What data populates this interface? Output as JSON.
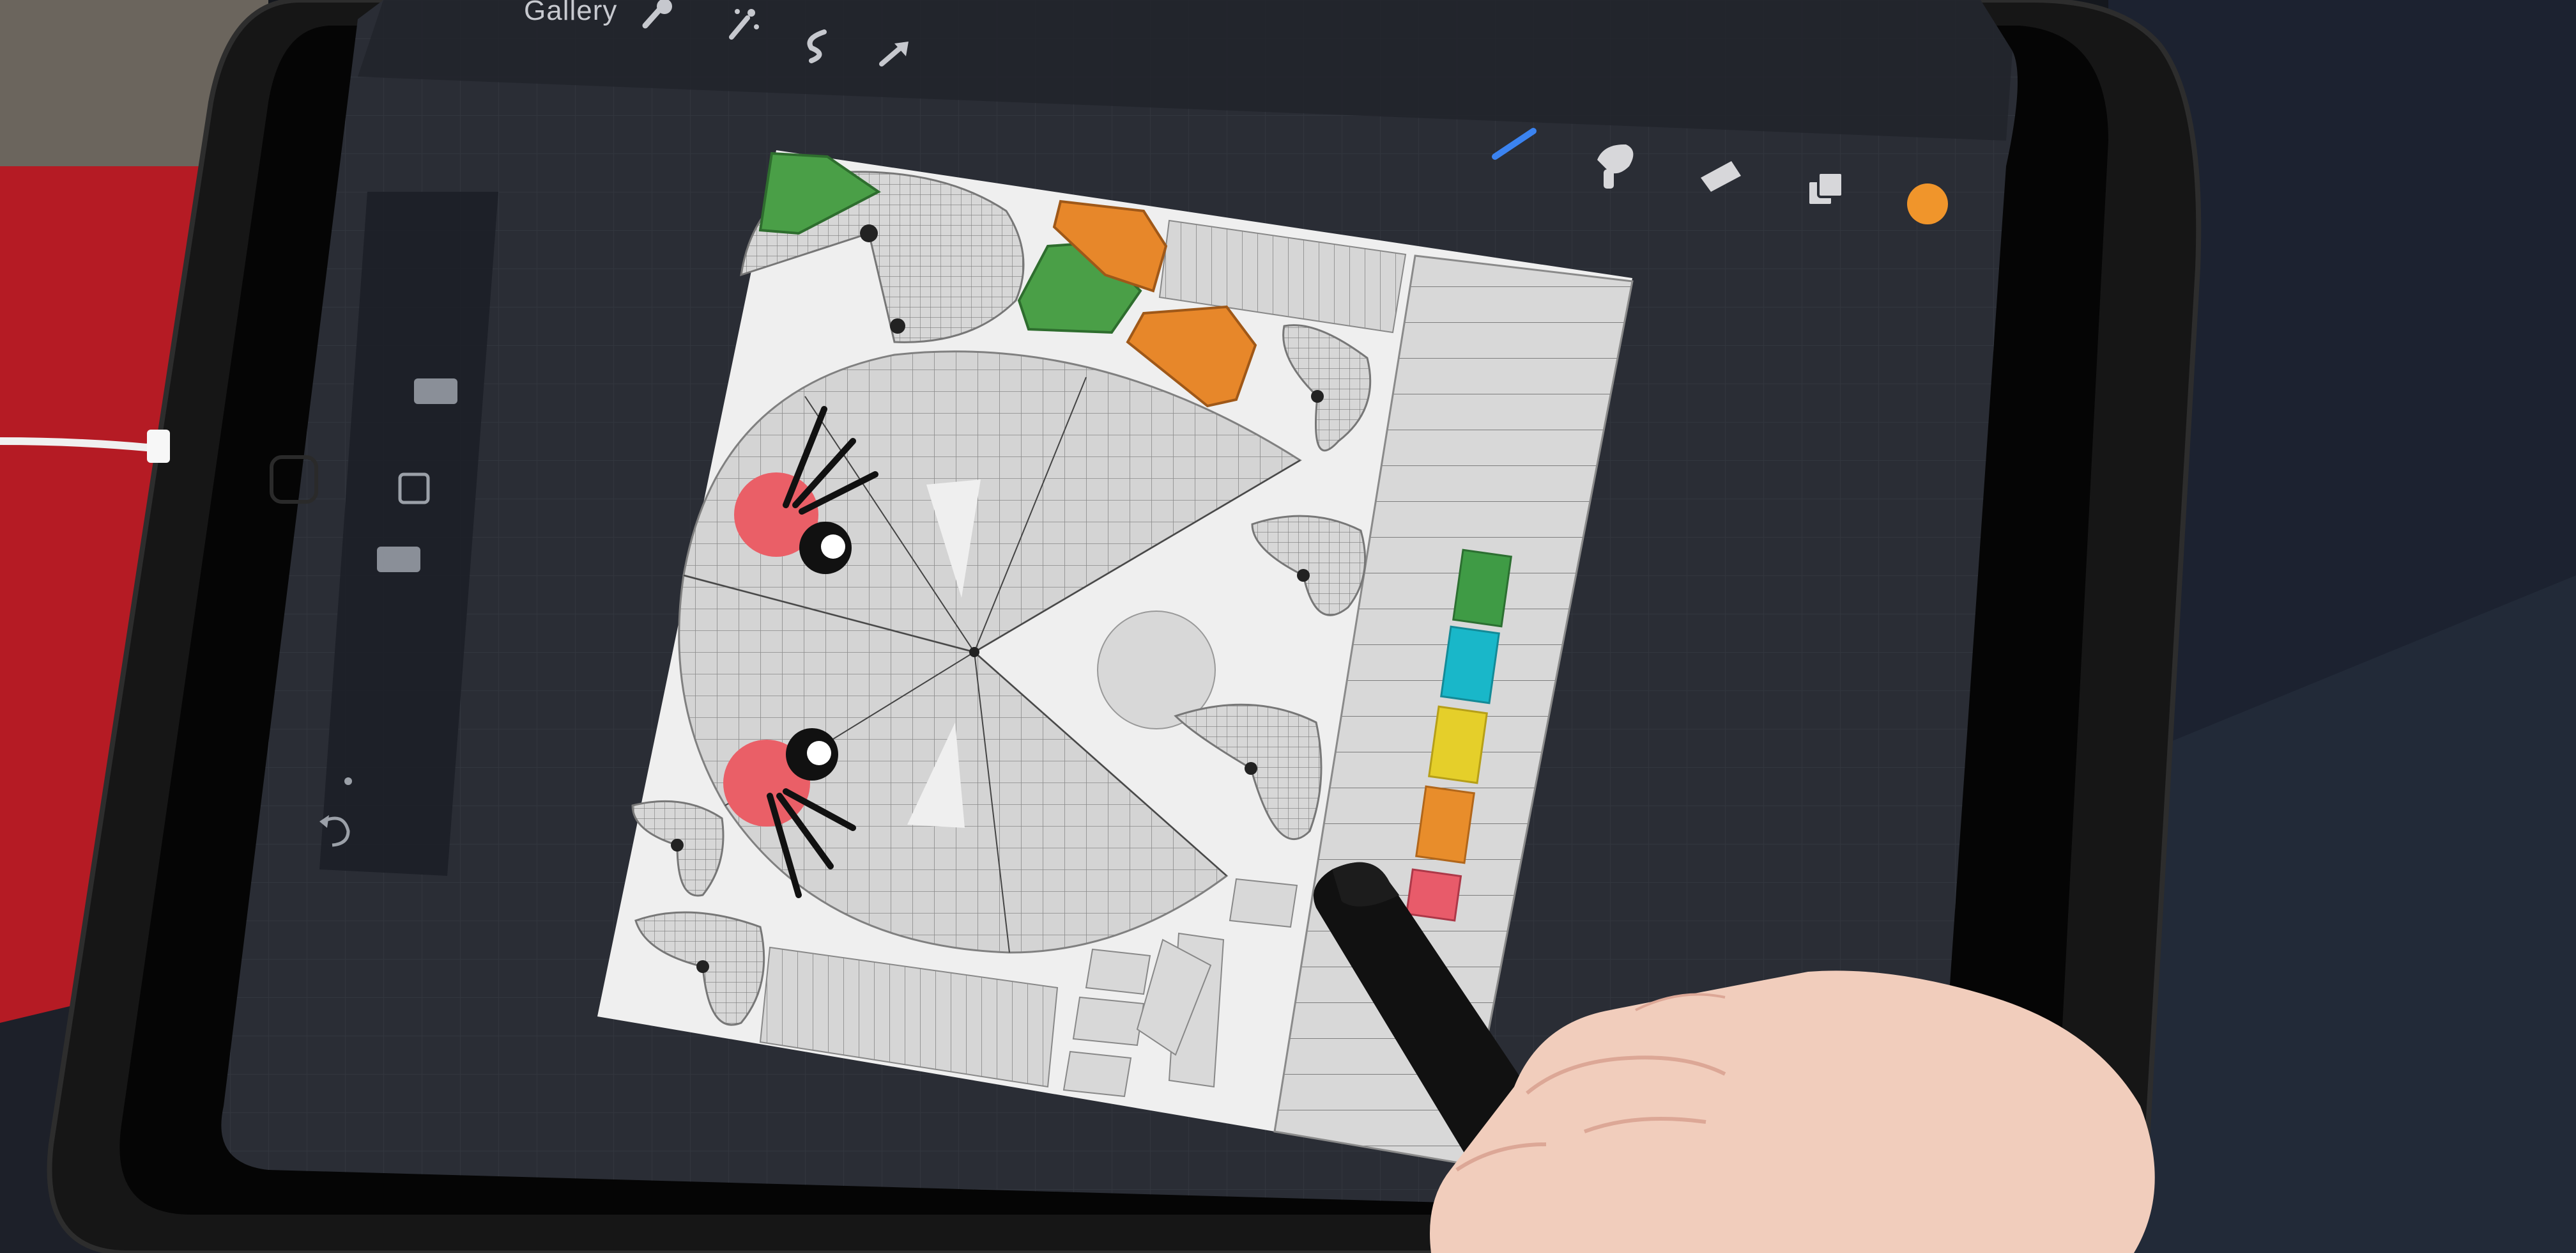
{
  "app": {
    "gallery_label": "Gallery"
  },
  "top_toolbar": {
    "actions_icon": "wrench-icon",
    "adjustments_icon": "magic-wand-icon",
    "selection_icon": "s-selection-icon",
    "transform_icon": "arrow-cursor-icon"
  },
  "right_toolbar": {
    "brush_icon": "brush-icon",
    "smudge_icon": "smudge-icon",
    "eraser_icon": "eraser-icon",
    "layers_icon": "layers-icon",
    "color_swatch": "#f0952b"
  },
  "left_sidebar": {
    "undo_icon": "undo-icon"
  },
  "palette": {
    "swatches": [
      "#3f9b45",
      "#19b7c9",
      "#e5cf2a",
      "#e88d2b",
      "#e85b6a"
    ]
  },
  "colors": {
    "canvas_bg": "#efefef",
    "workspace": "#2a2d35",
    "case": "#151515",
    "piece_gray": "#d5d5d5",
    "green": "#4a9f47",
    "orange": "#e7872a",
    "red": "#ea5f67"
  }
}
